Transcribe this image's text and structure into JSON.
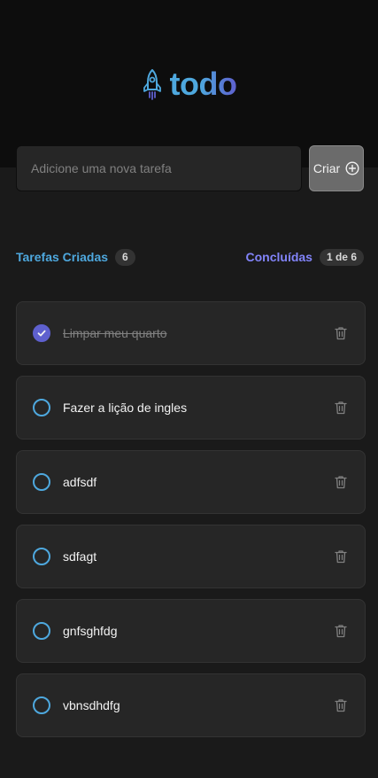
{
  "header": {
    "logo_text": "todo",
    "logo_icon": "rocket-icon"
  },
  "new_task": {
    "placeholder": "Adicione uma nova tarefa",
    "value": "",
    "create_label": "Criar",
    "create_icon": "plus-circle-icon"
  },
  "counters": {
    "created_label": "Tarefas Criadas",
    "created_count": "6",
    "done_label": "Concluídas",
    "done_count": "1 de 6"
  },
  "tasks": [
    {
      "text": "Limpar meu quarto",
      "completed": true
    },
    {
      "text": "Fazer a lição de ingles",
      "completed": false
    },
    {
      "text": "adfsdf",
      "completed": false
    },
    {
      "text": "sdfagt",
      "completed": false
    },
    {
      "text": "gnfsghfdg",
      "completed": false
    },
    {
      "text": "vbnsdhdfg",
      "completed": false
    }
  ],
  "colors": {
    "blue": "#4ea8de",
    "purple": "#8284fa",
    "purple_dark": "#5e60ce",
    "background": "#1a1a1a",
    "header": "#0d0d0d"
  }
}
